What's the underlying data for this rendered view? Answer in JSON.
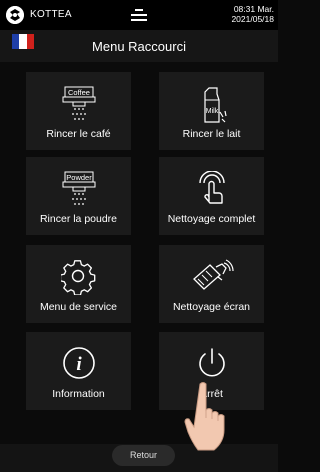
{
  "statusbar": {
    "brand": "KOTTEA",
    "time": "08:31 Mar.",
    "date": "2021/05/18",
    "icons": {
      "logo": "kottea-logo-icon",
      "menu": "hamburger-menu-icon"
    }
  },
  "header": {
    "title": "Menu Raccourci",
    "flag": {
      "name": "france-flag-icon",
      "colors": [
        "#1f3fa8",
        "#ffffff",
        "#d0211c"
      ]
    }
  },
  "tiles": [
    {
      "label": "Rincer le café",
      "icon": "coffee-rinse-icon",
      "icon_text": "Coffee"
    },
    {
      "label": "Rincer le lait",
      "icon": "milk-rinse-icon",
      "icon_text": "Milk"
    },
    {
      "label": "Rincer la poudre",
      "icon": "powder-rinse-icon",
      "icon_text": "Powder"
    },
    {
      "label": "Nettoyage complet",
      "icon": "touch-clean-icon"
    },
    {
      "label": "Menu de service",
      "icon": "gear-icon"
    },
    {
      "label": "Nettoyage écran",
      "icon": "screen-clean-icon"
    },
    {
      "label": "Information",
      "icon": "info-icon"
    },
    {
      "label": "Arrêt",
      "icon": "power-icon"
    }
  ],
  "footer": {
    "back_label": "Retour"
  },
  "colors": {
    "background": "#0b0b0b",
    "tile": "#1b1b1b",
    "header": "#161616",
    "text": "#ffffff"
  }
}
